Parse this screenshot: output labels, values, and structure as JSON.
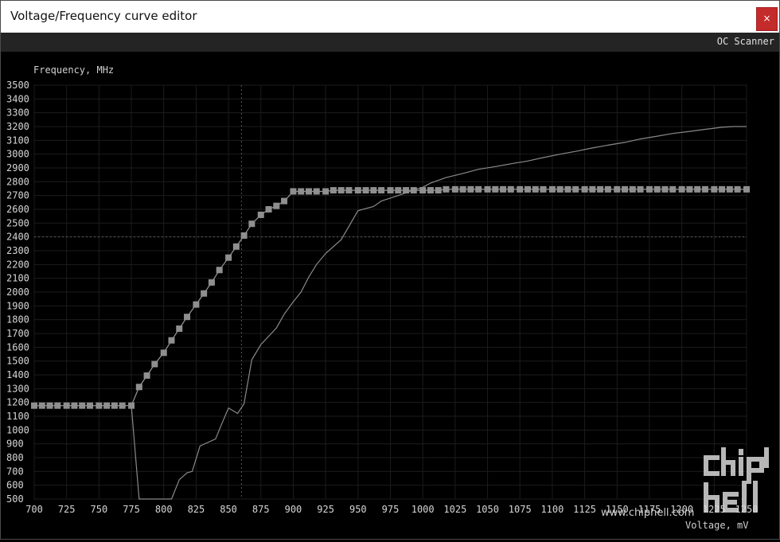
{
  "window": {
    "title": "Voltage/Frequency curve editor",
    "close_label": "×"
  },
  "toolbar": {
    "oc_scanner_label": "OC Scanner"
  },
  "watermark": {
    "url": "www.chiphell.com",
    "logo_text": "chip hell"
  },
  "chart_data": {
    "type": "line",
    "ylabel": "Frequency, MHz",
    "xlabel": "Voltage, mV",
    "xlim": [
      700,
      1250
    ],
    "ylim": [
      500,
      3500
    ],
    "xticks": [
      700,
      725,
      750,
      775,
      800,
      825,
      850,
      875,
      900,
      925,
      950,
      975,
      1000,
      1025,
      1050,
      1075,
      1100,
      1125,
      1150,
      1175,
      1200,
      1225,
      1250
    ],
    "yticks": [
      500,
      600,
      700,
      800,
      900,
      1000,
      1100,
      1200,
      1300,
      1400,
      1500,
      1600,
      1700,
      1800,
      1900,
      2000,
      2100,
      2200,
      2300,
      2400,
      2500,
      2600,
      2700,
      2800,
      2900,
      3000,
      3100,
      3200,
      3300,
      3400,
      3500
    ],
    "grid": true,
    "crosshair": {
      "x": 860,
      "y": 2400
    },
    "series": [
      {
        "role": "edited-curve",
        "color": "#9a9a9a",
        "markers": true,
        "points": [
          [
            700,
            1177
          ],
          [
            706,
            1177
          ],
          [
            712,
            1177
          ],
          [
            718,
            1177
          ],
          [
            725,
            1177
          ],
          [
            731,
            1177
          ],
          [
            737,
            1177
          ],
          [
            743,
            1177
          ],
          [
            750,
            1177
          ],
          [
            756,
            1177
          ],
          [
            762,
            1177
          ],
          [
            768,
            1177
          ],
          [
            775,
            1177
          ],
          [
            781,
            1312
          ],
          [
            787,
            1395
          ],
          [
            793,
            1478
          ],
          [
            800,
            1560
          ],
          [
            806,
            1650
          ],
          [
            812,
            1735
          ],
          [
            818,
            1820
          ],
          [
            825,
            1910
          ],
          [
            831,
            1990
          ],
          [
            837,
            2070
          ],
          [
            843,
            2160
          ],
          [
            850,
            2250
          ],
          [
            856,
            2330
          ],
          [
            862,
            2410
          ],
          [
            868,
            2495
          ],
          [
            875,
            2560
          ],
          [
            881,
            2600
          ],
          [
            887,
            2625
          ],
          [
            893,
            2660
          ],
          [
            900,
            2730
          ],
          [
            906,
            2730
          ],
          [
            912,
            2730
          ],
          [
            918,
            2730
          ],
          [
            925,
            2730
          ],
          [
            931,
            2738
          ],
          [
            937,
            2738
          ],
          [
            943,
            2738
          ],
          [
            950,
            2738
          ],
          [
            956,
            2738
          ],
          [
            962,
            2738
          ],
          [
            968,
            2738
          ],
          [
            975,
            2738
          ],
          [
            981,
            2738
          ],
          [
            987,
            2738
          ],
          [
            993,
            2738
          ],
          [
            1000,
            2738
          ],
          [
            1006,
            2738
          ],
          [
            1012,
            2738
          ],
          [
            1018,
            2745
          ],
          [
            1025,
            2745
          ],
          [
            1031,
            2745
          ],
          [
            1037,
            2745
          ],
          [
            1043,
            2745
          ],
          [
            1050,
            2745
          ],
          [
            1056,
            2745
          ],
          [
            1062,
            2745
          ],
          [
            1068,
            2745
          ],
          [
            1075,
            2745
          ],
          [
            1081,
            2745
          ],
          [
            1087,
            2745
          ],
          [
            1093,
            2745
          ],
          [
            1100,
            2745
          ],
          [
            1106,
            2745
          ],
          [
            1112,
            2745
          ],
          [
            1118,
            2745
          ],
          [
            1125,
            2745
          ],
          [
            1131,
            2745
          ],
          [
            1137,
            2745
          ],
          [
            1143,
            2745
          ],
          [
            1150,
            2745
          ],
          [
            1156,
            2745
          ],
          [
            1162,
            2745
          ],
          [
            1168,
            2745
          ],
          [
            1175,
            2745
          ],
          [
            1181,
            2745
          ],
          [
            1187,
            2745
          ],
          [
            1193,
            2745
          ],
          [
            1200,
            2745
          ],
          [
            1206,
            2745
          ],
          [
            1212,
            2745
          ],
          [
            1218,
            2745
          ],
          [
            1225,
            2745
          ],
          [
            1231,
            2745
          ],
          [
            1237,
            2745
          ],
          [
            1243,
            2745
          ],
          [
            1250,
            2745
          ]
        ]
      },
      {
        "role": "default-curve",
        "color": "#8a8a8a",
        "markers": false,
        "points": [
          [
            775,
            1177
          ],
          [
            781,
            500
          ],
          [
            806,
            500
          ],
          [
            812,
            640
          ],
          [
            818,
            690
          ],
          [
            822,
            700
          ],
          [
            828,
            885
          ],
          [
            840,
            935
          ],
          [
            845,
            1050
          ],
          [
            850,
            1160
          ],
          [
            857,
            1120
          ],
          [
            862,
            1190
          ],
          [
            868,
            1510
          ],
          [
            875,
            1620
          ],
          [
            887,
            1740
          ],
          [
            893,
            1840
          ],
          [
            900,
            1930
          ],
          [
            906,
            2000
          ],
          [
            912,
            2110
          ],
          [
            918,
            2200
          ],
          [
            925,
            2280
          ],
          [
            937,
            2380
          ],
          [
            950,
            2590
          ],
          [
            962,
            2620
          ],
          [
            968,
            2660
          ],
          [
            981,
            2700
          ],
          [
            993,
            2740
          ],
          [
            1000,
            2760
          ],
          [
            1006,
            2790
          ],
          [
            1018,
            2830
          ],
          [
            1031,
            2860
          ],
          [
            1043,
            2890
          ],
          [
            1056,
            2910
          ],
          [
            1068,
            2930
          ],
          [
            1081,
            2950
          ],
          [
            1093,
            2975
          ],
          [
            1106,
            3000
          ],
          [
            1118,
            3020
          ],
          [
            1131,
            3045
          ],
          [
            1143,
            3065
          ],
          [
            1156,
            3085
          ],
          [
            1168,
            3110
          ],
          [
            1181,
            3130
          ],
          [
            1193,
            3150
          ],
          [
            1206,
            3165
          ],
          [
            1218,
            3180
          ],
          [
            1231,
            3195
          ],
          [
            1240,
            3200
          ],
          [
            1250,
            3200
          ]
        ]
      }
    ]
  }
}
